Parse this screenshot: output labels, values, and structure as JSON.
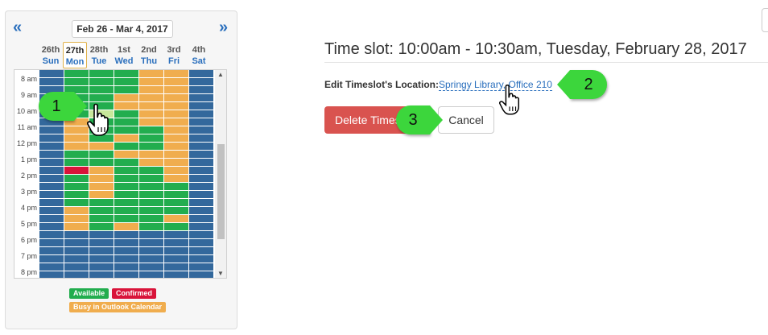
{
  "calendar": {
    "prev_label": "«",
    "next_label": "»",
    "date_range": "Feb 26 - Mar 4, 2017",
    "days": [
      {
        "num": "26th",
        "dow": "Sun"
      },
      {
        "num": "27th",
        "dow": "Mon"
      },
      {
        "num": "28th",
        "dow": "Tue"
      },
      {
        "num": "1st",
        "dow": "Wed"
      },
      {
        "num": "2nd",
        "dow": "Thu"
      },
      {
        "num": "3rd",
        "dow": "Fri"
      },
      {
        "num": "4th",
        "dow": "Sat"
      }
    ],
    "hours": [
      "8 am",
      "9 am",
      "10 am",
      "11 am",
      "12 pm",
      "1 pm",
      "2 pm",
      "3 pm",
      "4 pm",
      "5 pm",
      "6 pm",
      "7 pm",
      "8 pm"
    ],
    "colors": {
      "A": "#22ad4e",
      "B": "#f0ad4e",
      "C": "#d9143a",
      "U": "#33689c",
      "S": "#c8e89b"
    },
    "slots": [
      "UAAABBU",
      "UAAABBU",
      "UAAABBU",
      "UAABBBU",
      "UAABBBU",
      "UASABBU",
      "UBAABBU",
      "UBAAABU",
      "UBABABU",
      "UBBAABU",
      "UAABBBU",
      "UAAABBU",
      "UCBAABU",
      "UABAABU",
      "UABAAAU",
      "UABAAAU",
      "UAAAAAU",
      "UBAAAAU",
      "UBAAABU",
      "UBABAAU",
      "UUUUUUU",
      "UUUUUUU",
      "UUUUUUU",
      "UUUUUUU",
      "UUUUUUU",
      "UUUUUUU"
    ],
    "legend": {
      "available": "Available",
      "confirmed": "Confirmed",
      "busy": "Busy in Outlook Calendar"
    }
  },
  "detail": {
    "title": "Time slot: 10:00am - 10:30am, Tuesday, February 28, 2017",
    "location_label": "Edit Timeslot's Location:",
    "location_value": "Springy Library, Office 210",
    "delete_label": "Delete Timeslot",
    "cancel_label": "Cancel"
  },
  "callouts": [
    "1",
    "2",
    "3"
  ]
}
